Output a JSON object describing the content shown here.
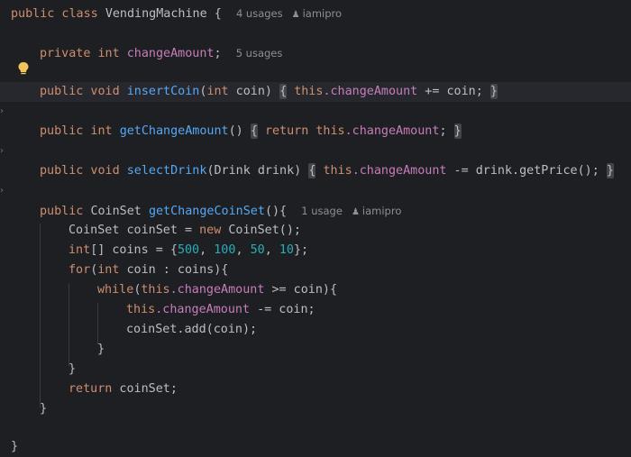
{
  "editor": {
    "lines": {
      "class_decl": {
        "kw": "public class",
        "name": "VendingMachine",
        "brace": "{",
        "usages": "4 usages",
        "author": "iamipro"
      },
      "field_decl": {
        "kw": "private int",
        "field": "changeAmount",
        "semi": ";",
        "usages": "5 usages"
      },
      "insert_coin": {
        "kw1": "public void",
        "method": "insertCoin",
        "params_open": "(",
        "param_type": "int",
        "param_name": " coin)",
        "fold_open": "{",
        "this_kw": "this",
        "field": ".changeAmount",
        "rest": " += coin;",
        "fold_close": "}"
      },
      "get_change": {
        "kw1": "public int",
        "method": "getChangeAmount",
        "parens": "()",
        "fold_open": "{",
        "ret_kw": "return",
        "this_kw": "this",
        "field": ".changeAmount",
        "semi": ";",
        "fold_close": "}"
      },
      "select_drink": {
        "kw1": "public void",
        "method": "selectDrink",
        "params": "(Drink drink)",
        "fold_open": "{",
        "this_kw": "this",
        "field": ".changeAmount",
        "rest": " -= drink.getPrice();",
        "fold_close": "}"
      },
      "get_coin_set": {
        "kw1": "public",
        "type": "CoinSet",
        "method": "getChangeCoinSet",
        "rest": "(){",
        "usages": "1 usage",
        "author": "iamipro"
      },
      "coinset_new": {
        "lhs": "CoinSet coinSet = ",
        "kw": "new",
        "rhs": " CoinSet();"
      },
      "coins_arr": {
        "kw": "int",
        "lhs": "[] coins = {",
        "n1": "500",
        "n2": "100",
        "n3": "50",
        "n4": "10",
        "sep": ", ",
        "end": "};"
      },
      "for_loop": {
        "kw": "for",
        "open": "(",
        "kw2": "int",
        "rest": " coin : coins){"
      },
      "while_loop": {
        "kw": "while",
        "open": "(",
        "this_kw": "this",
        "field": ".changeAmount",
        "rest": " >= coin){"
      },
      "subtract": {
        "this_kw": "this",
        "field": ".changeAmount",
        "rest": " -= coin;"
      },
      "add": {
        "text": "coinSet.add(coin);"
      },
      "close_while": {
        "text": "}"
      },
      "close_for": {
        "text": "}"
      },
      "return_stmt": {
        "kw": "return",
        "rest": " coinSet;"
      },
      "close_method": {
        "text": "}"
      },
      "close_class": {
        "text": "}"
      }
    },
    "colors": {
      "background": "#1e1f22",
      "keyword": "#cf8e6d",
      "method": "#56a8f5",
      "field": "#c77dbb",
      "number": "#2aacb8",
      "text": "#bcbec4",
      "hint": "#8c8f96"
    },
    "icons": {
      "bulb": "lightbulb-icon",
      "person": "person-icon",
      "gutter": "gutter-fold-arrow-icon"
    }
  }
}
